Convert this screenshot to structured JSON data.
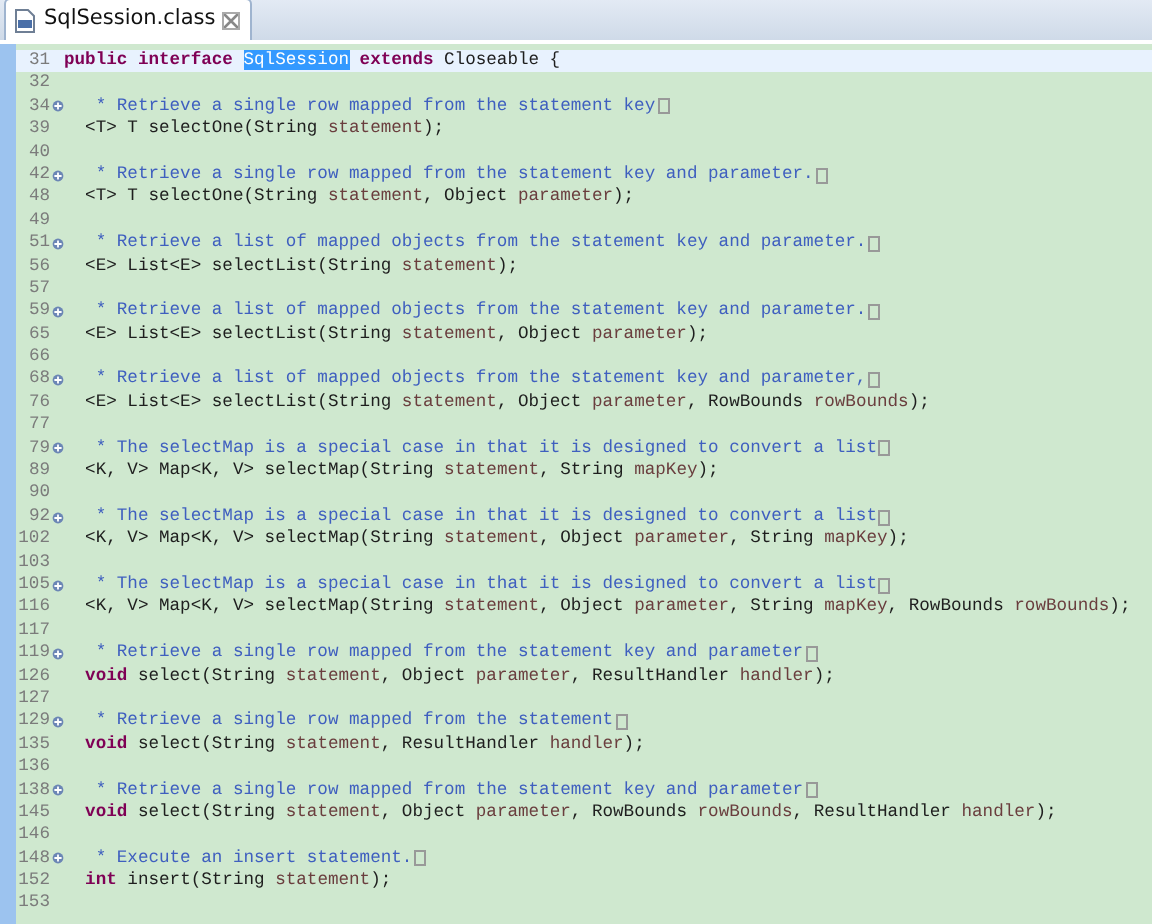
{
  "tab": {
    "label": "SqlSession.class",
    "selected": true
  },
  "lines": [
    {
      "number": "31",
      "current": true,
      "folded": false,
      "kind": "declaration",
      "tokens": [
        {
          "kind": "keyword",
          "text": "public interface"
        },
        {
          "kind": "selection",
          "text": "SqlSession"
        },
        {
          "kind": "keyword",
          "text": "extends"
        },
        {
          "kind": "plain",
          "text": "Closeable {"
        }
      ]
    },
    {
      "number": "32",
      "current": false,
      "folded": false
    },
    {
      "number": "34",
      "current": false,
      "folded": true,
      "kind": "comment",
      "tokens": [
        {
          "kind": "comment",
          "text": "* Retrieve a single row mapped from the statement key"
        }
      ]
    },
    {
      "number": "39",
      "current": false,
      "folded": false,
      "kind": "member",
      "tokens": [
        {
          "kind": "plain",
          "text": "<T> T selectOne(String "
        },
        {
          "kind": "param",
          "text": "statement"
        },
        {
          "kind": "plain",
          "text": ");"
        }
      ]
    },
    {
      "number": "40",
      "current": false,
      "folded": false
    },
    {
      "number": "42",
      "current": false,
      "folded": true,
      "kind": "comment",
      "tokens": [
        {
          "kind": "comment",
          "text": "* Retrieve a single row mapped from the statement key and parameter."
        }
      ]
    },
    {
      "number": "48",
      "current": false,
      "folded": false,
      "kind": "member",
      "tokens": [
        {
          "kind": "plain",
          "text": "<T> T selectOne(String "
        },
        {
          "kind": "param",
          "text": "statement"
        },
        {
          "kind": "plain",
          "text": ", Object "
        },
        {
          "kind": "param",
          "text": "parameter"
        },
        {
          "kind": "plain",
          "text": ");"
        }
      ]
    },
    {
      "number": "49",
      "current": false,
      "folded": false
    },
    {
      "number": "51",
      "current": false,
      "folded": true,
      "kind": "comment",
      "tokens": [
        {
          "kind": "comment",
          "text": "* Retrieve a list of mapped objects from the statement key and parameter."
        }
      ]
    },
    {
      "number": "56",
      "current": false,
      "folded": false,
      "kind": "member",
      "tokens": [
        {
          "kind": "plain",
          "text": "<E> List<E> selectList(String "
        },
        {
          "kind": "param",
          "text": "statement"
        },
        {
          "kind": "plain",
          "text": ");"
        }
      ]
    },
    {
      "number": "57",
      "current": false,
      "folded": false
    },
    {
      "number": "59",
      "current": false,
      "folded": true,
      "kind": "comment",
      "tokens": [
        {
          "kind": "comment",
          "text": "* Retrieve a list of mapped objects from the statement key and parameter."
        }
      ]
    },
    {
      "number": "65",
      "current": false,
      "folded": false,
      "kind": "member",
      "tokens": [
        {
          "kind": "plain",
          "text": "<E> List<E> selectList(String "
        },
        {
          "kind": "param",
          "text": "statement"
        },
        {
          "kind": "plain",
          "text": ", Object "
        },
        {
          "kind": "param",
          "text": "parameter"
        },
        {
          "kind": "plain",
          "text": ");"
        }
      ]
    },
    {
      "number": "66",
      "current": false,
      "folded": false
    },
    {
      "number": "68",
      "current": false,
      "folded": true,
      "kind": "comment",
      "tokens": [
        {
          "kind": "comment",
          "text": "* Retrieve a list of mapped objects from the statement key and parameter,"
        }
      ]
    },
    {
      "number": "76",
      "current": false,
      "folded": false,
      "kind": "member",
      "tokens": [
        {
          "kind": "plain",
          "text": "<E> List<E> selectList(String "
        },
        {
          "kind": "param",
          "text": "statement"
        },
        {
          "kind": "plain",
          "text": ", Object "
        },
        {
          "kind": "param",
          "text": "parameter"
        },
        {
          "kind": "plain",
          "text": ", RowBounds "
        },
        {
          "kind": "param",
          "text": "rowBounds"
        },
        {
          "kind": "plain",
          "text": ");"
        }
      ]
    },
    {
      "number": "77",
      "current": false,
      "folded": false
    },
    {
      "number": "79",
      "current": false,
      "folded": true,
      "kind": "comment",
      "tokens": [
        {
          "kind": "comment",
          "text": "* The selectMap is a special case in that it is designed to convert a list"
        }
      ]
    },
    {
      "number": "89",
      "current": false,
      "folded": false,
      "kind": "member",
      "tokens": [
        {
          "kind": "plain",
          "text": "<K, V> Map<K, V> selectMap(String "
        },
        {
          "kind": "param",
          "text": "statement"
        },
        {
          "kind": "plain",
          "text": ", String "
        },
        {
          "kind": "param",
          "text": "mapKey"
        },
        {
          "kind": "plain",
          "text": ");"
        }
      ]
    },
    {
      "number": "90",
      "current": false,
      "folded": false
    },
    {
      "number": "92",
      "current": false,
      "folded": true,
      "kind": "comment",
      "tokens": [
        {
          "kind": "comment",
          "text": "* The selectMap is a special case in that it is designed to convert a list"
        }
      ]
    },
    {
      "number": "102",
      "current": false,
      "folded": false,
      "kind": "member",
      "tokens": [
        {
          "kind": "plain",
          "text": "<K, V> Map<K, V> selectMap(String "
        },
        {
          "kind": "param",
          "text": "statement"
        },
        {
          "kind": "plain",
          "text": ", Object "
        },
        {
          "kind": "param",
          "text": "parameter"
        },
        {
          "kind": "plain",
          "text": ", String "
        },
        {
          "kind": "param",
          "text": "mapKey"
        },
        {
          "kind": "plain",
          "text": ");"
        }
      ]
    },
    {
      "number": "103",
      "current": false,
      "folded": false
    },
    {
      "number": "105",
      "current": false,
      "folded": true,
      "kind": "comment",
      "tokens": [
        {
          "kind": "comment",
          "text": "* The selectMap is a special case in that it is designed to convert a list"
        }
      ]
    },
    {
      "number": "116",
      "current": false,
      "folded": false,
      "kind": "member",
      "tokens": [
        {
          "kind": "plain",
          "text": "<K, V> Map<K, V> selectMap(String "
        },
        {
          "kind": "param",
          "text": "statement"
        },
        {
          "kind": "plain",
          "text": ", Object "
        },
        {
          "kind": "param",
          "text": "parameter"
        },
        {
          "kind": "plain",
          "text": ", String "
        },
        {
          "kind": "param",
          "text": "mapKey"
        },
        {
          "kind": "plain",
          "text": ", RowBounds "
        },
        {
          "kind": "param",
          "text": "rowBounds"
        },
        {
          "kind": "plain",
          "text": ");"
        }
      ]
    },
    {
      "number": "117",
      "current": false,
      "folded": false
    },
    {
      "number": "119",
      "current": false,
      "folded": true,
      "kind": "comment",
      "tokens": [
        {
          "kind": "comment",
          "text": "* Retrieve a single row mapped from the statement key and parameter"
        }
      ]
    },
    {
      "number": "126",
      "current": false,
      "folded": false,
      "kind": "member",
      "tokens": [
        {
          "kind": "keyword",
          "text": "void"
        },
        {
          "kind": "plain",
          "text": " select(String "
        },
        {
          "kind": "param",
          "text": "statement"
        },
        {
          "kind": "plain",
          "text": ", Object "
        },
        {
          "kind": "param",
          "text": "parameter"
        },
        {
          "kind": "plain",
          "text": ", ResultHandler "
        },
        {
          "kind": "param",
          "text": "handler"
        },
        {
          "kind": "plain",
          "text": ");"
        }
      ]
    },
    {
      "number": "127",
      "current": false,
      "folded": false
    },
    {
      "number": "129",
      "current": false,
      "folded": true,
      "kind": "comment",
      "tokens": [
        {
          "kind": "comment",
          "text": "* Retrieve a single row mapped from the statement"
        }
      ]
    },
    {
      "number": "135",
      "current": false,
      "folded": false,
      "kind": "member",
      "tokens": [
        {
          "kind": "keyword",
          "text": "void"
        },
        {
          "kind": "plain",
          "text": " select(String "
        },
        {
          "kind": "param",
          "text": "statement"
        },
        {
          "kind": "plain",
          "text": ", ResultHandler "
        },
        {
          "kind": "param",
          "text": "handler"
        },
        {
          "kind": "plain",
          "text": ");"
        }
      ]
    },
    {
      "number": "136",
      "current": false,
      "folded": false
    },
    {
      "number": "138",
      "current": false,
      "folded": true,
      "kind": "comment",
      "tokens": [
        {
          "kind": "comment",
          "text": "* Retrieve a single row mapped from the statement key and parameter"
        }
      ]
    },
    {
      "number": "145",
      "current": false,
      "folded": false,
      "kind": "member",
      "tokens": [
        {
          "kind": "keyword",
          "text": "void"
        },
        {
          "kind": "plain",
          "text": " select(String "
        },
        {
          "kind": "param",
          "text": "statement"
        },
        {
          "kind": "plain",
          "text": ", Object "
        },
        {
          "kind": "param",
          "text": "parameter"
        },
        {
          "kind": "plain",
          "text": ", RowBounds "
        },
        {
          "kind": "param",
          "text": "rowBounds"
        },
        {
          "kind": "plain",
          "text": ", ResultHandler "
        },
        {
          "kind": "param",
          "text": "handler"
        },
        {
          "kind": "plain",
          "text": ");"
        }
      ]
    },
    {
      "number": "146",
      "current": false,
      "folded": false
    },
    {
      "number": "148",
      "current": false,
      "folded": true,
      "kind": "comment",
      "tokens": [
        {
          "kind": "comment",
          "text": "* Execute an insert statement."
        }
      ]
    },
    {
      "number": "152",
      "current": false,
      "folded": false,
      "kind": "member",
      "tokens": [
        {
          "kind": "keyword",
          "text": "int"
        },
        {
          "kind": "plain",
          "text": " insert(String "
        },
        {
          "kind": "param",
          "text": "statement"
        },
        {
          "kind": "plain",
          "text": ");"
        }
      ]
    },
    {
      "number": "153",
      "current": false,
      "folded": false
    }
  ]
}
